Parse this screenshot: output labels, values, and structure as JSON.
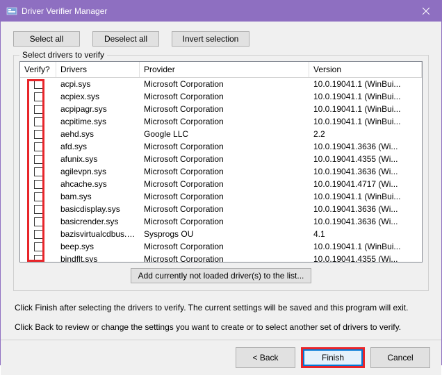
{
  "window": {
    "title": "Driver Verifier Manager"
  },
  "buttons": {
    "select_all": "Select all",
    "deselect_all": "Deselect all",
    "invert_selection": "Invert selection",
    "add_not_loaded": "Add currently not loaded driver(s) to the list...",
    "back": "< Back",
    "finish": "Finish",
    "cancel": "Cancel"
  },
  "group": {
    "label": "Select drivers to verify"
  },
  "columns": {
    "verify": "Verify?",
    "drivers": "Drivers",
    "provider": "Provider",
    "version": "Version"
  },
  "drivers": [
    {
      "name": "acpi.sys",
      "provider": "Microsoft Corporation",
      "version": "10.0.19041.1 (WinBui..."
    },
    {
      "name": "acpiex.sys",
      "provider": "Microsoft Corporation",
      "version": "10.0.19041.1 (WinBui..."
    },
    {
      "name": "acpipagr.sys",
      "provider": "Microsoft Corporation",
      "version": "10.0.19041.1 (WinBui..."
    },
    {
      "name": "acpitime.sys",
      "provider": "Microsoft Corporation",
      "version": "10.0.19041.1 (WinBui..."
    },
    {
      "name": "aehd.sys",
      "provider": "Google LLC",
      "version": "2.2"
    },
    {
      "name": "afd.sys",
      "provider": "Microsoft Corporation",
      "version": "10.0.19041.3636 (Wi..."
    },
    {
      "name": "afunix.sys",
      "provider": "Microsoft Corporation",
      "version": "10.0.19041.4355 (Wi..."
    },
    {
      "name": "agilevpn.sys",
      "provider": "Microsoft Corporation",
      "version": "10.0.19041.3636 (Wi..."
    },
    {
      "name": "ahcache.sys",
      "provider": "Microsoft Corporation",
      "version": "10.0.19041.4717 (Wi..."
    },
    {
      "name": "bam.sys",
      "provider": "Microsoft Corporation",
      "version": "10.0.19041.1 (WinBui..."
    },
    {
      "name": "basicdisplay.sys",
      "provider": "Microsoft Corporation",
      "version": "10.0.19041.3636 (Wi..."
    },
    {
      "name": "basicrender.sys",
      "provider": "Microsoft Corporation",
      "version": "10.0.19041.3636 (Wi..."
    },
    {
      "name": "bazisvirtualcdbus.sys",
      "provider": "Sysprogs OU",
      "version": "4.1"
    },
    {
      "name": "beep.sys",
      "provider": "Microsoft Corporation",
      "version": "10.0.19041.1 (WinBui..."
    },
    {
      "name": "bindflt.sys",
      "provider": "Microsoft Corporation",
      "version": "10.0.19041.4355 (Wi..."
    }
  ],
  "hints": {
    "line1": "Click Finish after selecting the drivers to verify. The current settings will be saved and this program will exit.",
    "line2": "Click Back to review or change the settings you want to create or to select another set of drivers to verify."
  }
}
